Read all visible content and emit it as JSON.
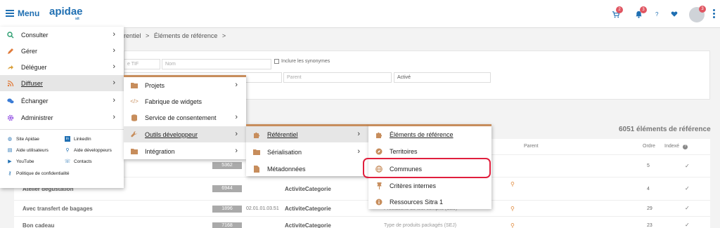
{
  "header": {
    "menu_label": "Menu",
    "logo_text": "apidae",
    "logo_sub": "sit",
    "cart_badge": "2",
    "bell_badge": "3",
    "help_icon": "?",
    "avatar_badge": "3"
  },
  "page": {
    "breadcrumb_a": "rentiel",
    "breadcrumb_sep": ">",
    "breadcrumb_b": "Éléments de référence",
    "breadcrumb_end": ">",
    "filter_code_placeholder": "e TIF",
    "filter_name_placeholder": "Nom",
    "include_synonyms": "Inclure les synonymes",
    "parent_placeholder": "Parent",
    "status_value": "Activé",
    "count_text": "6051 éléments de référence",
    "col_parent": "Parent",
    "col_ordre": "Ordre",
    "col_indexe": "Indexé",
    "rows": [
      {
        "name": "",
        "id": "5362",
        "code": "",
        "type": "",
        "parent": "",
        "ordre": "5"
      },
      {
        "name": "Atelier dégustation",
        "id": "6944",
        "code": "",
        "type": "ActiviteCategorie",
        "parent": "",
        "ordre": "4"
      },
      {
        "name": "Avec transfert de bagages",
        "id": "1896",
        "code": "02.01.01.03.51",
        "type": "ActiviteCategorie",
        "parent": "Prestations du tout compris (SEJ)",
        "ordre": "29"
      },
      {
        "name": "Bon cadeau",
        "id": "7168",
        "code": "",
        "type": "ActiviteCategorie",
        "parent": "Type de produits packagés (SEJ)",
        "ordre": "23"
      }
    ]
  },
  "menu_main": [
    {
      "label": "Consulter",
      "icon": "search-icon",
      "color": "#2a9d6f"
    },
    {
      "label": "Gérer",
      "icon": "pencil-icon",
      "color": "#e07a3a"
    },
    {
      "label": "Déléguer",
      "icon": "share-icon",
      "color": "#d9a03a"
    },
    {
      "label": "Diffuser",
      "icon": "rss-icon",
      "color": "#e07a3a"
    },
    {
      "label": "Échanger",
      "icon": "chat-icon",
      "color": "#3a7bd5"
    },
    {
      "label": "Administrer",
      "icon": "gear-icon",
      "color": "#9b5de5"
    }
  ],
  "menu_links": [
    {
      "label": "Site Apidae",
      "icon": "globe-icon"
    },
    {
      "label": "LinkedIn",
      "icon": "linkedin-icon"
    },
    {
      "label": "Aide utilisateurs",
      "icon": "book-icon"
    },
    {
      "label": "Aide développeurs",
      "icon": "search-icon"
    },
    {
      "label": "YouTube",
      "icon": "youtube-icon"
    },
    {
      "label": "Contacts",
      "icon": "phone-icon"
    },
    {
      "label": "Politique de confidentialité",
      "icon": "key-icon"
    }
  ],
  "menu_diffuser": [
    {
      "label": "Projets",
      "icon": "folder-icon"
    },
    {
      "label": "Fabrique de widgets",
      "icon": "code-icon"
    },
    {
      "label": "Service de consentement",
      "icon": "database-icon"
    },
    {
      "label": "Outils développeur",
      "icon": "wrench-icon"
    },
    {
      "label": "Intégration",
      "icon": "folder-icon"
    }
  ],
  "menu_outils": [
    {
      "label": "Référentiel",
      "icon": "puzzle-icon"
    },
    {
      "label": "Sérialisation",
      "icon": "folder-icon"
    },
    {
      "label": "Métadonnées",
      "icon": "file-icon"
    }
  ],
  "menu_referentiel": [
    {
      "label": "Éléments de référence",
      "icon": "puzzle-icon"
    },
    {
      "label": "Territoires",
      "icon": "compass-icon"
    },
    {
      "label": "Communes",
      "icon": "globe-icon"
    },
    {
      "label": "Critères internes",
      "icon": "pin-icon"
    },
    {
      "label": "Ressources Sitra 1",
      "icon": "info-icon"
    }
  ],
  "colors": {
    "accent_blue": "#1f6fb2",
    "menu_accent": "#c78d5c",
    "highlight_red": "#e01f3d",
    "badge_red": "#e05561"
  }
}
